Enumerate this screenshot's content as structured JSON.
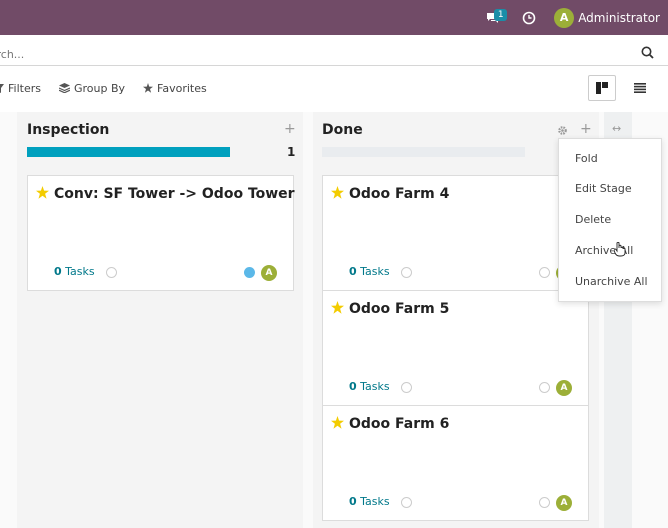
{
  "navbar": {
    "chat_count": "1",
    "user_initial": "A",
    "user_name": "Administrator"
  },
  "search": {
    "placeholder": "Search..."
  },
  "filters": {
    "filters_label": "Filters",
    "group_by_label": "Group By",
    "favorites_label": "Favorites"
  },
  "columns": [
    {
      "title": "Inspection",
      "count": "1",
      "progress": 1.0,
      "cards": [
        {
          "title": "Conv: SF Tower -> Odoo Tower",
          "tasks_count": "0",
          "tasks_label": "Tasks",
          "avatar": "A"
        }
      ]
    },
    {
      "title": "Done",
      "count": "",
      "progress": 0.0,
      "cards": [
        {
          "title": "Odoo Farm 4",
          "tasks_count": "0",
          "tasks_label": "Tasks",
          "avatar": "A"
        },
        {
          "title": "Odoo Farm 5",
          "tasks_count": "0",
          "tasks_label": "Tasks",
          "avatar": "A"
        },
        {
          "title": "Odoo Farm 6",
          "tasks_count": "0",
          "tasks_label": "Tasks",
          "avatar": "A"
        }
      ]
    }
  ],
  "dropdown": {
    "items": [
      "Fold",
      "Edit Stage",
      "Delete",
      "Archive All",
      "Unarchive All"
    ]
  },
  "colors": {
    "navbar": "#714B67",
    "progress": "#00A0BE",
    "avatar": "#9CAF38",
    "star": "#F3CC00"
  }
}
